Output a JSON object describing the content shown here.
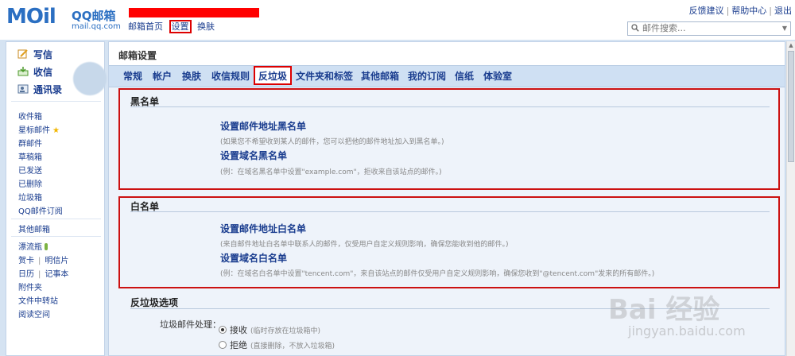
{
  "header": {
    "logo_word": "MOil",
    "logo_brand": "QQ邮箱",
    "logo_domain": "mail.qq.com",
    "nav": [
      "邮箱首页",
      "设置",
      "换肤"
    ],
    "links": [
      "反馈建议",
      "帮助中心",
      "退出"
    ],
    "search_placeholder": "邮件搜索..."
  },
  "sidebar": {
    "quick": [
      "写信",
      "收信",
      "通讯录"
    ],
    "folders": [
      "收件箱",
      "星标邮件",
      "群邮件",
      "草稿箱",
      "已发送",
      "已删除",
      "垃圾箱",
      "QQ邮件订阅"
    ],
    "other": "其他邮箱",
    "apps": {
      "drift": "漂流瓶",
      "card": "贺卡",
      "postcard": "明信片",
      "calendar": "日历",
      "notes": "记事本",
      "attachments": "附件夹",
      "transfer": "文件中转站",
      "reading": "阅读空间"
    }
  },
  "main": {
    "title": "邮箱设置",
    "tabs": [
      "常规",
      "帐户",
      "换肤",
      "收信规则",
      "反垃圾",
      "文件夹和标签",
      "其他邮箱",
      "我的订阅",
      "信纸",
      "体验室"
    ],
    "active_tab": "反垃圾",
    "blacklist": {
      "title": "黑名单",
      "items": [
        {
          "title": "设置邮件地址黑名单",
          "desc": "(如果您不希望收到某人的邮件，您可以把他的邮件地址加入到黑名单。)"
        },
        {
          "title": "设置域名黑名单",
          "desc": "(例：在域名黑名单中设置\"example.com\"，拒收来自该站点的邮件。)"
        }
      ]
    },
    "whitelist": {
      "title": "白名单",
      "items": [
        {
          "title": "设置邮件地址白名单",
          "desc": "(来自邮件地址白名单中联系人的邮件，仅受用户自定义规则影响，确保您能收到他的邮件。)"
        },
        {
          "title": "设置域名白名单",
          "desc": "(例：在域名白名单中设置\"tencent.com\"，来自该站点的邮件仅受用户自定义规则影响，确保您收到\"@tencent.com\"发来的所有邮件。)"
        }
      ]
    },
    "options": {
      "title": "反垃圾选项",
      "label": "垃圾邮件处理：",
      "choices": [
        {
          "label": "接收",
          "note": "(临时存放在垃圾箱中)",
          "selected": true
        },
        {
          "label": "拒绝",
          "note": "(直接删除，不放入垃圾箱)",
          "selected": false
        }
      ]
    }
  },
  "watermark": {
    "brand": "Bai 经验",
    "url": "jingyan.baidu.com"
  },
  "colors": {
    "accent": "#1a3d8f",
    "highlight": "#dd0000",
    "panel": "#eef3fa",
    "tabbar": "#cfe0f3"
  }
}
